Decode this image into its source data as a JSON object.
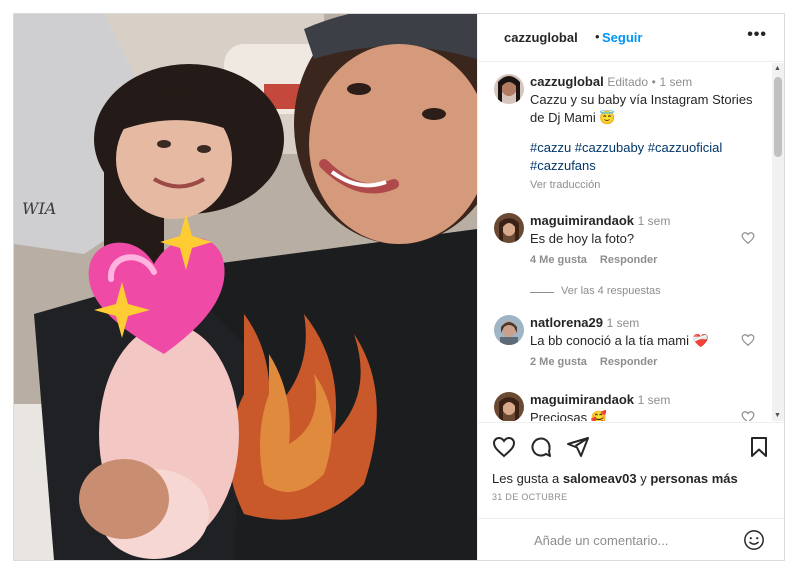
{
  "post": {
    "username": "cazzuglobal",
    "follow_label": "Seguir",
    "more_label": "•••"
  },
  "caption": {
    "username": "cazzuglobal",
    "edited": "Editado",
    "separator": "•",
    "time": "1 sem",
    "line1": "Cazzu y su baby vía Instagram Stories",
    "line2": "de Dj Mami 😇",
    "hashtags_line1": "#cazzu #cazzubaby #cazzuoficial",
    "hashtags_line2": "#cazzufans",
    "translate_label": "Ver traducción"
  },
  "comments": [
    {
      "username": "maguimirandaok",
      "time": "1 sem",
      "text": "Es de hoy la foto?",
      "likes": "4 Me gusta",
      "reply": "Responder"
    },
    {
      "username": "natlorena29",
      "time": "1 sem",
      "text": "La bb conoció a la tía mami ❤️‍🩹",
      "likes": "2 Me gusta",
      "reply": "Responder"
    },
    {
      "username": "maguimirandaok",
      "time": "1 sem",
      "text": "Preciosas 🥰"
    }
  ],
  "view_replies_label": "Ver las 4 respuestas",
  "likes_summary": {
    "prefix": "Les gusta a",
    "user": "salomeav03",
    "connector": "y",
    "rest": "personas más"
  },
  "date": "31 DE OCTUBRE",
  "add_comment_placeholder": "Añade un comentario...",
  "icons": {
    "like": "heart-icon",
    "comment": "comment-icon",
    "share": "send-icon",
    "save": "bookmark-icon",
    "emoji": "emoji-icon"
  },
  "colors": {
    "link_blue": "#0095f6",
    "hashtag": "#00376b",
    "muted": "#8e8e8e",
    "border": "#dbdbdb"
  }
}
